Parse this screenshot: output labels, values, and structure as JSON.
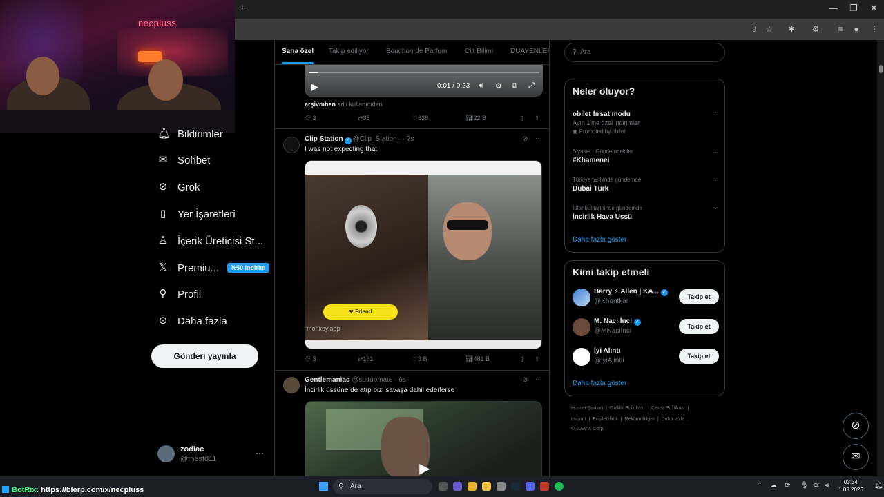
{
  "webcam": {
    "brand": "necpluss"
  },
  "browser": {
    "new_tab_label": "+"
  },
  "nav": {
    "items": [
      {
        "label": "Bildirimler",
        "icon": "bell-icon"
      },
      {
        "label": "Sohbet",
        "icon": "mail-icon"
      },
      {
        "label": "Grok",
        "icon": "grok-icon"
      },
      {
        "label": "Yer İşaretleri",
        "icon": "bookmark-icon"
      },
      {
        "label": "İçerik Üreticisi St...",
        "icon": "creator-studio-icon"
      },
      {
        "label": "Premiu...",
        "icon": "x-icon",
        "badge": "%50 indirim"
      },
      {
        "label": "Profil",
        "icon": "person-icon"
      },
      {
        "label": "Daha fazla",
        "icon": "more-circle-icon"
      }
    ],
    "post_button": "Gönderi yayınla",
    "account": {
      "name": "zodiac",
      "handle": "@thesfd11",
      "more": "···"
    }
  },
  "timeline": {
    "tabs": [
      "Sana özel",
      "Takip ediliyor",
      "Bouchon de Parfum",
      "Cilt Bilimi",
      "DUAYENLER"
    ],
    "post1": {
      "video_time": "0:01 / 0:23",
      "source_user": "arşivmhen",
      "source_suffix": "adlı kullanıcıdan",
      "replies": "3",
      "reposts": "35",
      "likes": "638",
      "views": "22 B"
    },
    "post2": {
      "name": "Clip Station",
      "handle": "@Clip_Station_",
      "time": "· 7s",
      "text": "I was not expecting that",
      "friend_button": "Friend",
      "watermark": "monkey.app",
      "replies": "3",
      "reposts": "161",
      "likes": "3 B",
      "views": "481 B"
    },
    "post3": {
      "name": "Gentlemaniac",
      "handle": "@suitupmate",
      "time": "· 9s",
      "text": "İncirlik üssüne de atıp bizi savaşa dahil ederlerse"
    }
  },
  "right": {
    "search_placeholder": "Ara",
    "trends_title": "Neler oluyor?",
    "trends": [
      {
        "context": "",
        "title": "obilet fırsat modu",
        "subtitle": "Ayın 1'ine özel indirimler",
        "promo": "Promoted by obilet"
      },
      {
        "context": "Siyaset · Gündemdekiler",
        "title": "#Khamenei",
        "subtitle": "",
        "promo": ""
      },
      {
        "context": "Türkiye tarihinde gündemde",
        "title": "Dubai Türk",
        "subtitle": "",
        "promo": ""
      },
      {
        "context": "İstanbul tarihinde gündemde",
        "title": "İncirlik Hava Üssü",
        "subtitle": "",
        "promo": ""
      }
    ],
    "show_more": "Daha fazla göster",
    "who_title": "Kimi takip etmeli",
    "who": [
      {
        "name": "Barry ⚡ Allen | KA...",
        "handle": "@Khontkar",
        "button": "Takip et"
      },
      {
        "name": "M. Naci İnci",
        "handle": "@MNaciInci",
        "button": "Takip et"
      },
      {
        "name": "İyi Alıntı",
        "handle": "@iyiAlintii",
        "button": "Takip et"
      }
    ],
    "who_show_more": "Daha fazla göster",
    "footer_line1": [
      "Hizmet Şartları",
      "|",
      "Gizlilik Politikası",
      "|",
      "Çerez Politikası",
      "|"
    ],
    "footer_line2": [
      "Imprint",
      "|",
      "Erişilebilirlik",
      "|",
      "Reklam bilgisi",
      "|",
      "Daha fazla ..."
    ],
    "footer_line3": "© 2026 X Corp."
  },
  "taskbar": {
    "botrix_name": "BotRix",
    "botrix_text": ": https://blerp.com/x/necpluss",
    "search_label": "Ara",
    "time": "03:34",
    "date": "1.03.2026"
  }
}
